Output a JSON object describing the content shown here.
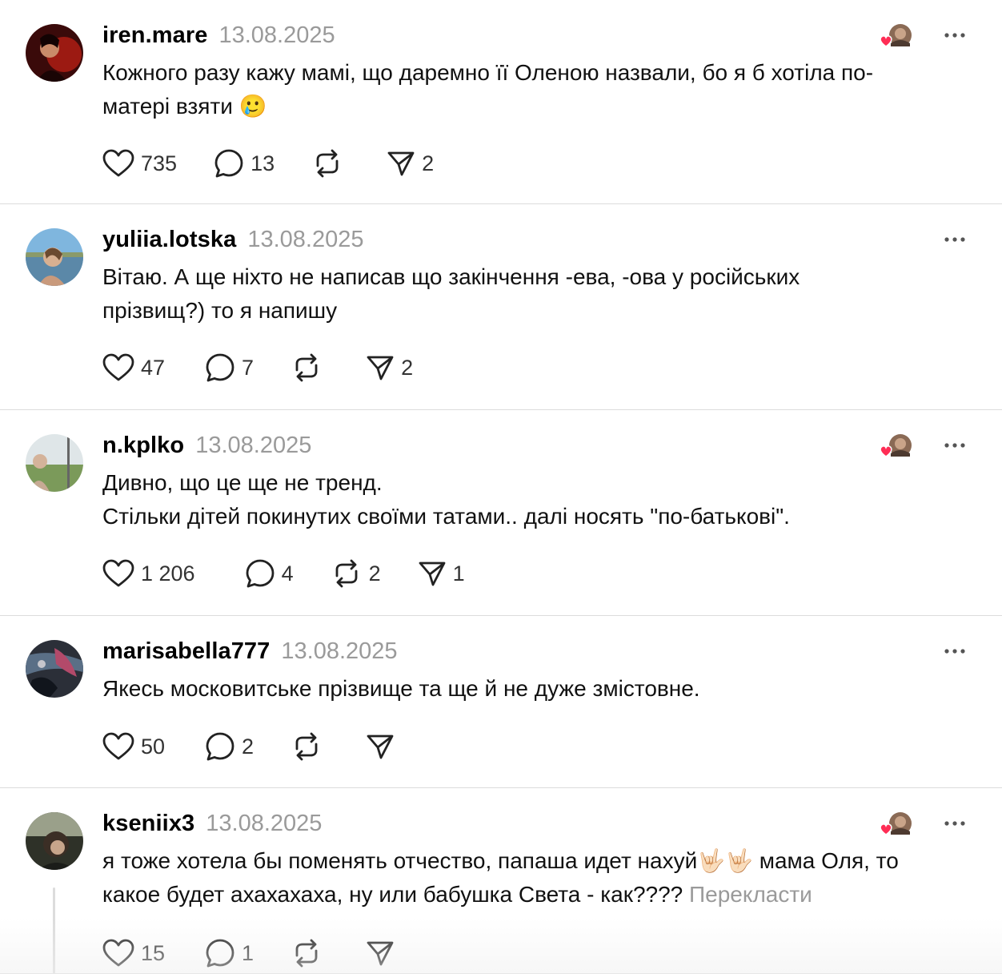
{
  "posts": [
    {
      "username": "iren.mare",
      "date": "13.08.2025",
      "text": "Кожного разу кажу мамі, що даремно її Оленою назвали, бо я б хотіла по-\nматері взяти 🥲",
      "translate": "",
      "likes": "735",
      "replies": "13",
      "reposts": "",
      "shares": "2",
      "liked_by_author": true
    },
    {
      "username": "yuliia.lotska",
      "date": "13.08.2025",
      "text": "Вітаю. А ще ніхто не написав що закінчення -ева, -ова у російських\nпрізвищ?) то я напишу",
      "translate": "",
      "likes": "47",
      "replies": "7",
      "reposts": "",
      "shares": "2",
      "liked_by_author": false
    },
    {
      "username": "n.kplko",
      "date": "13.08.2025",
      "text": "Дивно, що це ще не тренд.\nСтільки дітей покинутих своїми татами.. далі носять \"по-батькові\".",
      "translate": "",
      "likes": "1 206",
      "replies": "4",
      "reposts": "2",
      "shares": "1",
      "liked_by_author": true
    },
    {
      "username": "marisabella777",
      "date": "13.08.2025",
      "text": "Якесь московитське прізвище та ще й не дуже змістовне.",
      "translate": "",
      "likes": "50",
      "replies": "2",
      "reposts": "",
      "shares": "",
      "liked_by_author": false
    },
    {
      "username": "kseniix3",
      "date": "13.08.2025",
      "text": "я тоже хотела бы поменять отчество, папаша идет нахуй🤟🏻🤟🏻 мама Оля, то\nкакое будет ахахахаха, ну или бабушка Света - как????  ",
      "translate": "Перекласти",
      "likes": "15",
      "replies": "1",
      "reposts": "",
      "shares": "",
      "liked_by_author": true
    }
  ],
  "colors": {
    "muted": "#9a9a9a",
    "divider": "#dcdcdc",
    "heart": "#ff2d55"
  },
  "icons": [
    "heart-icon",
    "comment-icon",
    "repost-icon",
    "share-icon",
    "more-icon"
  ]
}
